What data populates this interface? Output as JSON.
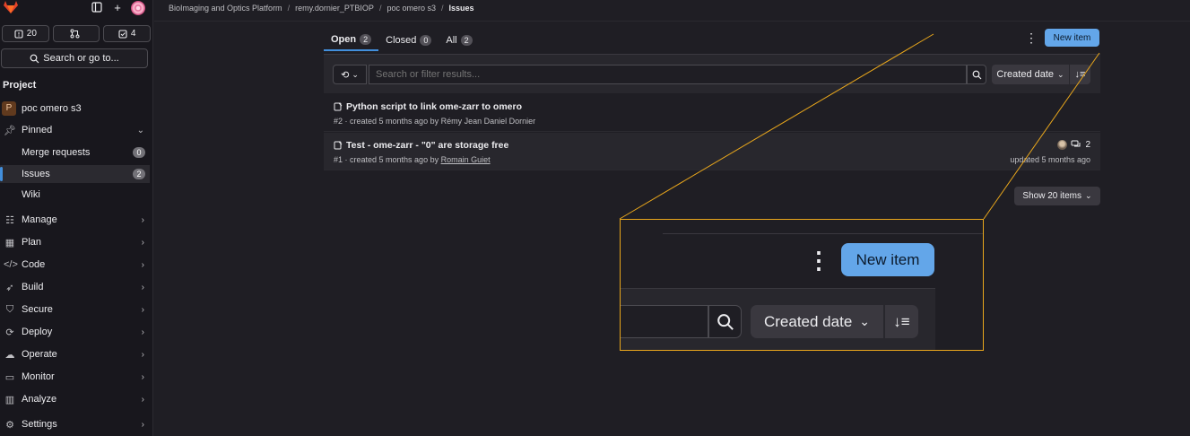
{
  "sidebar": {
    "counters": [
      {
        "icon": "issues-icon",
        "count": "20"
      },
      {
        "icon": "merge-request-icon",
        "count": ""
      },
      {
        "icon": "todo-icon",
        "count": "4"
      }
    ],
    "search_label": "Search or go to...",
    "section_title": "Project",
    "project_name": "poc omero s3",
    "project_initial": "P",
    "pinned_label": "Pinned",
    "pinned_items": [
      {
        "label": "Merge requests",
        "badge": "0"
      },
      {
        "label": "Issues",
        "badge": "2"
      },
      {
        "label": "Wiki",
        "badge": ""
      }
    ],
    "menu": [
      {
        "label": "Manage",
        "icon": "users-icon"
      },
      {
        "label": "Plan",
        "icon": "calendar-icon"
      },
      {
        "label": "Code",
        "icon": "code-icon"
      },
      {
        "label": "Build",
        "icon": "rocket-icon"
      },
      {
        "label": "Secure",
        "icon": "shield-icon"
      },
      {
        "label": "Deploy",
        "icon": "deploy-icon"
      },
      {
        "label": "Operate",
        "icon": "cloud-icon"
      },
      {
        "label": "Monitor",
        "icon": "monitor-icon"
      },
      {
        "label": "Analyze",
        "icon": "chart-icon"
      },
      {
        "label": "Settings",
        "icon": "settings-icon"
      }
    ]
  },
  "breadcrumbs": [
    "BioImaging and Optics Platform",
    "remy.dornier_PTBIOP",
    "poc omero s3",
    "Issues"
  ],
  "tabs": [
    {
      "label": "Open",
      "count": "2"
    },
    {
      "label": "Closed",
      "count": "0"
    },
    {
      "label": "All",
      "count": "2"
    }
  ],
  "new_item_label": "New item",
  "filter": {
    "placeholder": "Search or filter results...",
    "sort_label": "Created date"
  },
  "issues": [
    {
      "title": "Python script to link ome-zarr to omero",
      "ref": "#2",
      "meta_prefix": " · created 5 months ago by ",
      "author": "Rémy Jean Daniel Dornier",
      "comments": "",
      "updated": ""
    },
    {
      "title": "Test - ome-zarr - \"0\" are storage free",
      "ref": "#1",
      "meta_prefix": " · created 5 months ago by ",
      "author": "Romain Guiet",
      "comments": "2",
      "updated": "updated 5 months ago"
    }
  ],
  "show_items_label": "Show 20 items",
  "zoom": {
    "new_item_label": "New item",
    "sort_label": "Created date"
  },
  "colors": {
    "accent": "#63a6e9",
    "zoom_frame": "#e9a71c",
    "background": "#1f1e24",
    "sidebar": "#18171d"
  }
}
